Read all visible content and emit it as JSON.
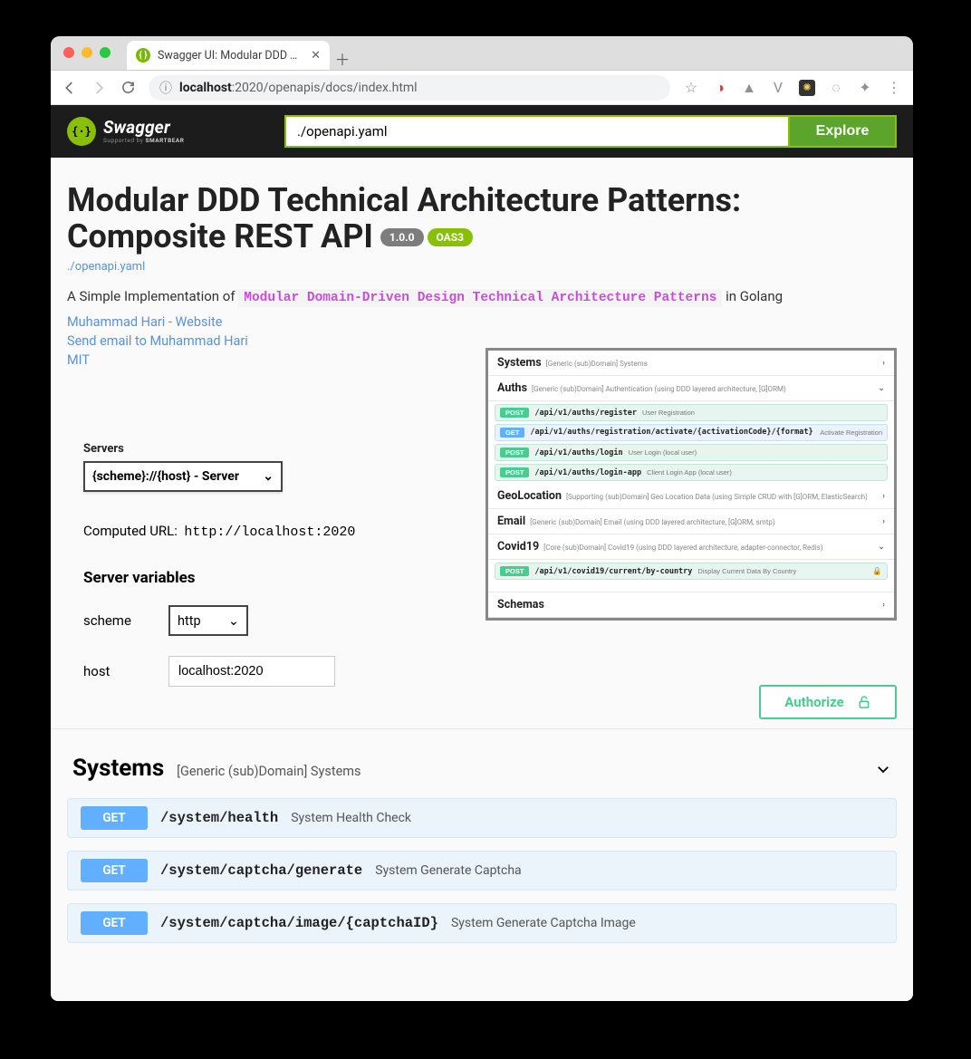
{
  "browser": {
    "tab_title": "Swagger UI: Modular DDD Tec",
    "url_host": "localhost",
    "url_path": ":2020/openapis/docs/index.html"
  },
  "header": {
    "logo_main": "Swagger",
    "logo_sub_prefix": "Supported by ",
    "logo_sub_bold": "SMARTBEAR",
    "spec_url": "./openapi.yaml",
    "explore": "Explore"
  },
  "info": {
    "title": "Modular DDD Technical Architecture Patterns: Composite REST API",
    "version": "1.0.0",
    "oas": "OAS3",
    "spec_link": "./openapi.yaml",
    "desc_prefix": "A Simple Implementation of ",
    "desc_code": "Modular Domain-Driven Design Technical Architecture Patterns",
    "desc_suffix": " in Golang",
    "author_site": "Muhammad Hari - Website",
    "author_email": "Send email to Muhammad Hari",
    "license": "MIT"
  },
  "servers": {
    "label": "Servers",
    "selected": "{scheme}://{host} - Server",
    "computed_label": "Computed URL:",
    "computed_url": "http://localhost:2020",
    "vars_label": "Server variables",
    "scheme_label": "scheme",
    "scheme_value": "http",
    "host_label": "host",
    "host_value": "localhost:2020"
  },
  "authorize": {
    "label": "Authorize"
  },
  "thumb": {
    "tags": [
      {
        "name": "Systems",
        "desc": "[Generic (sub)Domain] Systems",
        "chev": "›"
      },
      {
        "name": "Auths",
        "desc": "[Generic (sub)Domain] Authentication (using DDD layered architecture, [G]ORM)",
        "chev": "⌄"
      }
    ],
    "auths_ops": [
      {
        "m": "POST",
        "path": "/api/v1/auths/register",
        "d": "User Registration"
      },
      {
        "m": "GET",
        "path": "/api/v1/auths/registration/activate/{activationCode}/{format}",
        "d": "Activate Registration"
      },
      {
        "m": "POST",
        "path": "/api/v1/auths/login",
        "d": "User Login (local user)"
      },
      {
        "m": "POST",
        "path": "/api/v1/auths/login-app",
        "d": "Client Login App (local user)"
      }
    ],
    "more_tags": [
      {
        "name": "GeoLocation",
        "desc": "[Supporting (sub)Domain] Geo Location Data (using Simple CRUD with [G]ORM, ElasticSearch)",
        "chev": "›"
      },
      {
        "name": "Email",
        "desc": "[Generic (sub)Domain] Email (using DDD layered architecture, [G]ORM, smtp)",
        "chev": "›"
      },
      {
        "name": "Covid19",
        "desc": "[Core (sub)Domain] Covid19 (using DDD layered architecture, adapter-connector, Redis)",
        "chev": "⌄"
      }
    ],
    "covid_op": {
      "m": "POST",
      "path": "/api/v1/covid19/current/by-country",
      "d": "Display Current Data By Country"
    },
    "schemas": {
      "name": "Schemas",
      "chev": "›"
    }
  },
  "tag": {
    "name": "Systems",
    "desc": "[Generic (sub)Domain] Systems",
    "ops": [
      {
        "method": "GET",
        "path": "/system/health",
        "desc": "System Health Check"
      },
      {
        "method": "GET",
        "path": "/system/captcha/generate",
        "desc": "System Generate Captcha"
      },
      {
        "method": "GET",
        "path": "/system/captcha/image/{captchaID}",
        "desc": "System Generate Captcha Image"
      }
    ]
  }
}
